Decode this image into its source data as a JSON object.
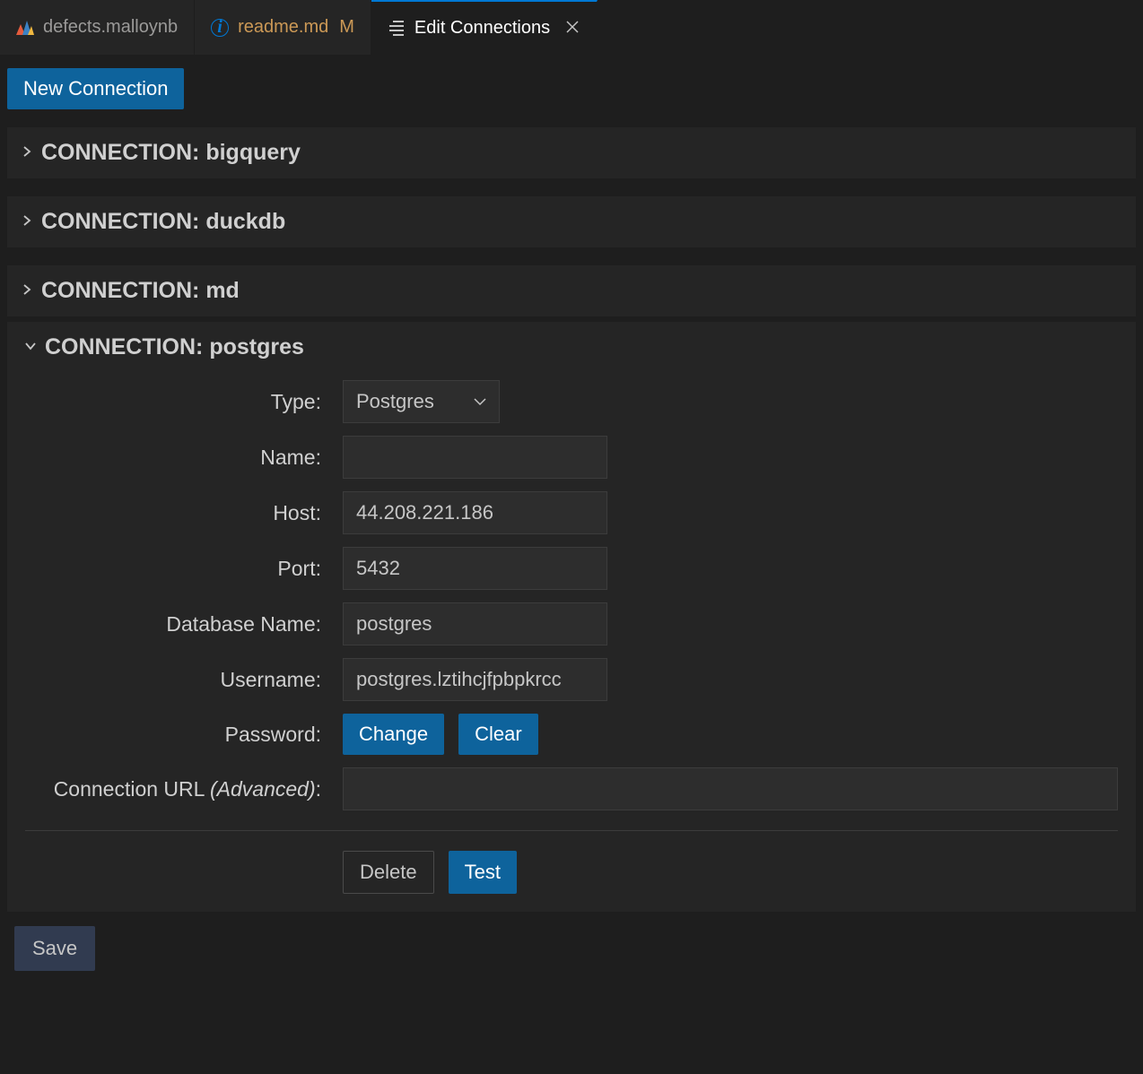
{
  "tabs": {
    "tab1": {
      "label": "defects.malloynb"
    },
    "tab2": {
      "label": "readme.md",
      "modified": "M"
    },
    "tab3": {
      "label": "Edit Connections"
    }
  },
  "toolbar": {
    "new_connection": "New Connection",
    "save": "Save"
  },
  "connections": {
    "bigquery": {
      "header": "CONNECTION: bigquery"
    },
    "duckdb": {
      "header": "CONNECTION: duckdb"
    },
    "md": {
      "header": "CONNECTION: md"
    },
    "postgres": {
      "header": "CONNECTION: postgres"
    }
  },
  "form": {
    "type_label": "Type:",
    "type_value": "Postgres",
    "name_label": "Name:",
    "name_value": "",
    "host_label": "Host:",
    "host_value": "44.208.221.186",
    "port_label": "Port:",
    "port_value": "5432",
    "dbname_label": "Database Name:",
    "dbname_value": "postgres",
    "username_label": "Username:",
    "username_value": "postgres.lztihcjfpbpkrcc",
    "password_label": "Password:",
    "password_change": "Change",
    "password_clear": "Clear",
    "connurl_label_pre": "Connection URL ",
    "connurl_label_italic": "(Advanced)",
    "connurl_label_post": ":",
    "connurl_value": "",
    "delete": "Delete",
    "test": "Test"
  }
}
